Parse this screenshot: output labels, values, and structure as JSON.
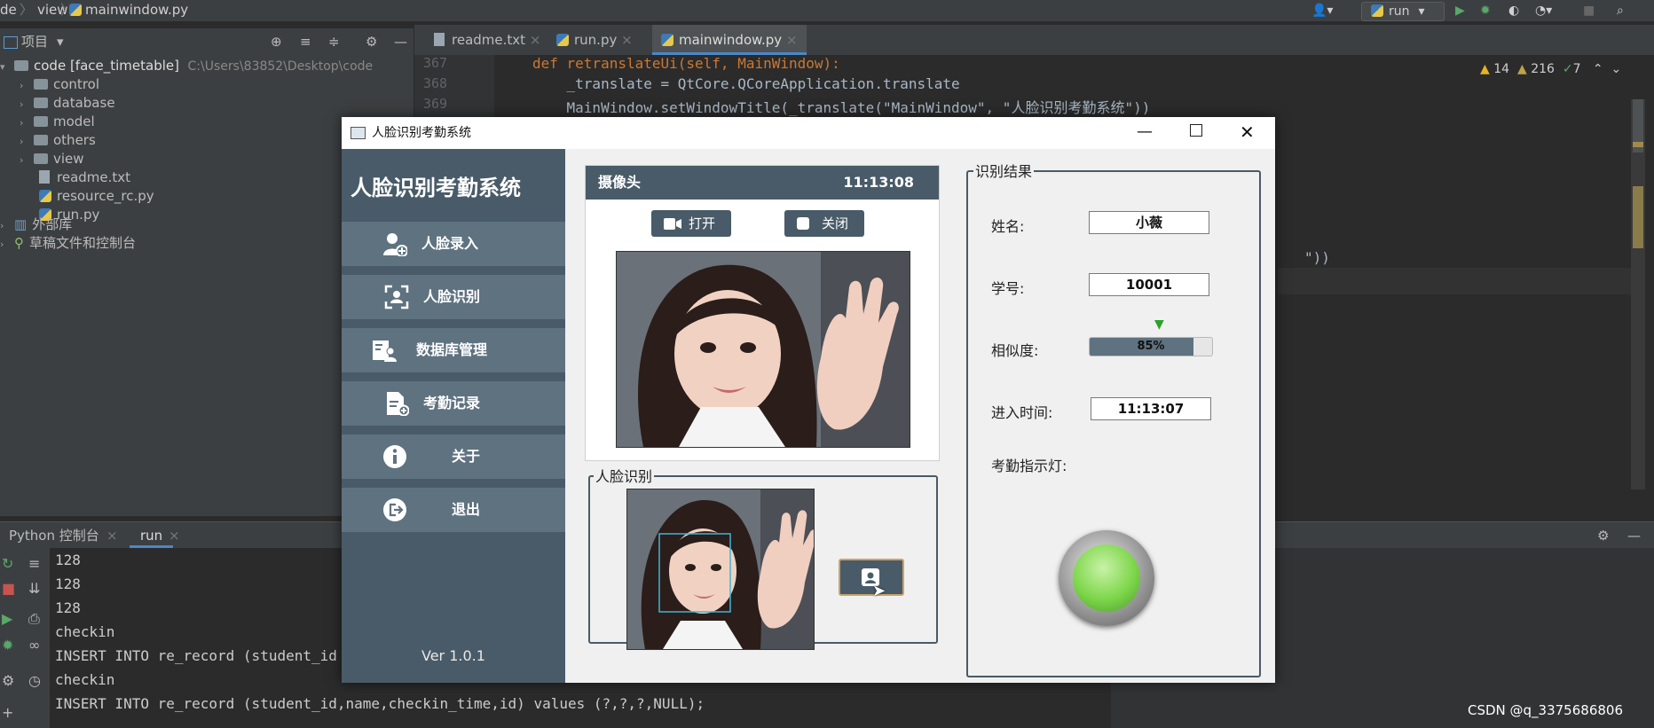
{
  "ide": {
    "breadcrumb": [
      "de",
      "view",
      "mainwindow.py"
    ],
    "run_config": "run",
    "project_label": "项目",
    "tree": [
      {
        "label": "code [face_timetable]",
        "path": "C:\\Users\\83852\\Desktop\\code",
        "kind": "folder"
      },
      {
        "label": "control",
        "kind": "folder"
      },
      {
        "label": "database",
        "kind": "folder"
      },
      {
        "label": "model",
        "kind": "folder"
      },
      {
        "label": "others",
        "kind": "folder"
      },
      {
        "label": "view",
        "kind": "folder"
      },
      {
        "label": "readme.txt",
        "kind": "file"
      },
      {
        "label": "resource_rc.py",
        "kind": "py"
      },
      {
        "label": "run.py",
        "kind": "py"
      },
      {
        "label": "外部库",
        "kind": "lib"
      },
      {
        "label": "草稿文件和控制台",
        "kind": "lib"
      }
    ],
    "tabs": [
      "readme.txt",
      "run.py",
      "mainwindow.py"
    ],
    "active_tab": "mainwindow.py",
    "line_numbers": [
      "367",
      "368",
      "369"
    ],
    "code_lines": [
      "def retranslateUi(self, MainWindow):",
      "    _translate = QtCore.QCoreApplication.translate",
      "    MainWindow.setWindowTitle(_translate(\"MainWindow\", \"人脸识别考勤系统\"))"
    ],
    "code_fragments": [
      "\"))",
      "\"))"
    ],
    "inspections": {
      "warn": "14",
      "weak": "216",
      "ok": "7"
    },
    "bottom_tabs": [
      "Python 控制台",
      "run"
    ],
    "console_lines": [
      "128",
      "128",
      "128",
      "checkin",
      "INSERT INTO re_record (student_id",
      "checkin",
      "INSERT INTO re_record (student_id,name,checkin_time,id) values (?,?,?,NULL);"
    ],
    "watermark": "CSDN @q_3375686806"
  },
  "app": {
    "window_title": "人脸识别考勤系统",
    "brand": "人脸识别考勤系统",
    "nav": [
      "人脸录入",
      "人脸识别",
      "数据库管理",
      "考勤记录",
      "关于",
      "退出"
    ],
    "version": "Ver 1.0.1",
    "camera": {
      "title": "摄像头",
      "time": "11:13:08",
      "open_label": "打开",
      "close_label": "关闭"
    },
    "face_group_title": "人脸识别",
    "result": {
      "title": "识别结果",
      "name_label": "姓名:",
      "name": "小薇",
      "id_label": "学号:",
      "id": "10001",
      "similarity_label": "相似度:",
      "similarity": "85%",
      "similarity_value": 0.85,
      "time_label": "进入时间:",
      "time": "11:13:07",
      "light_label": "考勤指示灯:",
      "light_color": "#7dd64a"
    }
  }
}
